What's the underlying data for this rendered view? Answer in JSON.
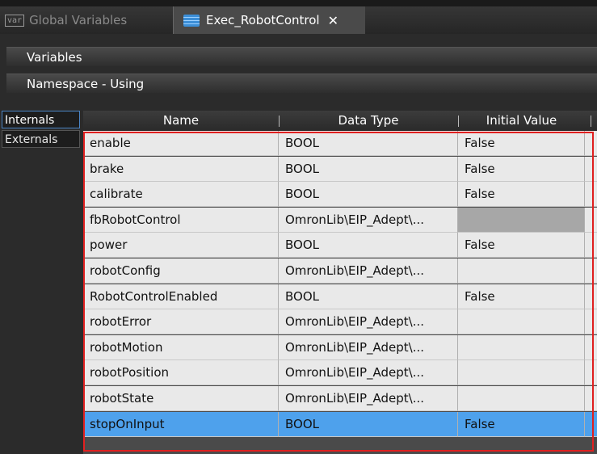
{
  "tabs": [
    {
      "label": "Global Variables",
      "icon": "var-icon",
      "icon_text": "var",
      "active": false
    },
    {
      "label": "Exec_RobotControl",
      "icon": "document-icon",
      "active": true,
      "close": "✕"
    }
  ],
  "sections": {
    "variables": "Variables",
    "namespace": "Namespace - Using"
  },
  "side_tabs": [
    "Internals",
    "Externals"
  ],
  "table": {
    "columns": [
      "Name",
      "Data Type",
      "Initial Value"
    ],
    "rows": [
      {
        "name": "enable",
        "type": "BOOL",
        "initial": "False"
      },
      {
        "name": "brake",
        "type": "BOOL",
        "initial": "False"
      },
      {
        "name": "calibrate",
        "type": "BOOL",
        "initial": "False"
      },
      {
        "name": "fbRobotControl",
        "type": "OmronLib\\EIP_Adept\\...",
        "initial": ""
      },
      {
        "name": "power",
        "type": "BOOL",
        "initial": "False"
      },
      {
        "name": "robotConfig",
        "type": "OmronLib\\EIP_Adept\\...",
        "initial": ""
      },
      {
        "name": "RobotControlEnabled",
        "type": "BOOL",
        "initial": "False"
      },
      {
        "name": "robotError",
        "type": "OmronLib\\EIP_Adept\\...",
        "initial": ""
      },
      {
        "name": "robotMotion",
        "type": "OmronLib\\EIP_Adept\\...",
        "initial": ""
      },
      {
        "name": "robotPosition",
        "type": "OmronLib\\EIP_Adept\\...",
        "initial": ""
      },
      {
        "name": "robotState",
        "type": "OmronLib\\EIP_Adept\\...",
        "initial": ""
      },
      {
        "name": "stopOnInput",
        "type": "BOOL",
        "initial": "False"
      }
    ],
    "selected_row": 11
  },
  "colors": {
    "selection": "#4ea1ec",
    "highlight_border": "#e02020"
  }
}
